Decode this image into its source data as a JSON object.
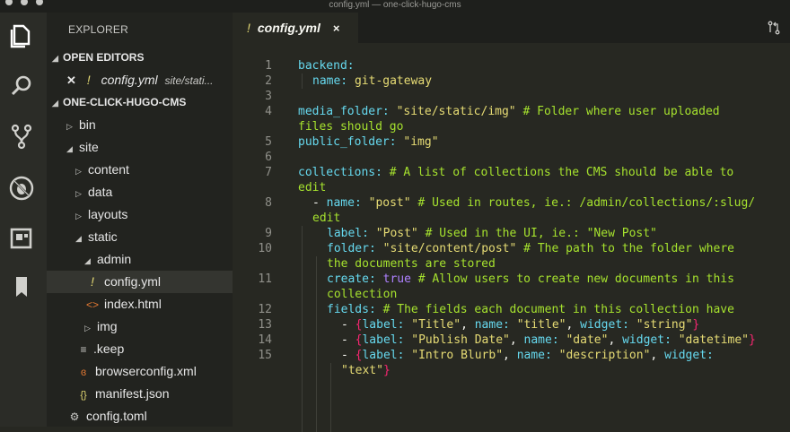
{
  "window": {
    "title": "config.yml — one-click-hugo-cms"
  },
  "sidebar": {
    "header": "EXPLORER",
    "open_editors_label": "OPEN EDITORS",
    "open_editor": {
      "name": "config.yml",
      "path": "site/stati..."
    },
    "project_label": "ONE-CLICK-HUGO-CMS",
    "tree": [
      {
        "label": "bin",
        "type": "folder",
        "state": "collapsed"
      },
      {
        "label": "site",
        "type": "folder",
        "state": "expanded"
      },
      {
        "label": "content",
        "type": "folder",
        "state": "collapsed"
      },
      {
        "label": "data",
        "type": "folder",
        "state": "collapsed"
      },
      {
        "label": "layouts",
        "type": "folder",
        "state": "collapsed"
      },
      {
        "label": "static",
        "type": "folder",
        "state": "expanded"
      },
      {
        "label": "admin",
        "type": "folder",
        "state": "expanded"
      },
      {
        "label": "config.yml",
        "type": "file",
        "icon": "yaml-icon"
      },
      {
        "label": "index.html",
        "type": "file",
        "icon": "html-icon"
      },
      {
        "label": "img",
        "type": "folder",
        "state": "collapsed"
      },
      {
        "label": ".keep",
        "type": "file",
        "icon": "text-file-icon"
      },
      {
        "label": "browserconfig.xml",
        "type": "file",
        "icon": "rss-icon"
      },
      {
        "label": "manifest.json",
        "type": "file",
        "icon": "json-icon"
      },
      {
        "label": "config.toml",
        "type": "file",
        "icon": "gear-file-icon"
      }
    ]
  },
  "editor": {
    "tab": {
      "label": "config.yml",
      "close": "×"
    },
    "line_numbers": [
      "1",
      "2",
      "3",
      "4",
      "",
      "5",
      "6",
      "7",
      "",
      "8",
      "",
      "9",
      "10",
      "",
      "11",
      "",
      "12",
      "13",
      "14",
      "15",
      ""
    ],
    "lines": {
      "l1": "backend:",
      "l2a": "name: ",
      "l2b": "git-gateway",
      "l4a": "media_folder: ",
      "l4b": "\"site/static/img\"",
      "l4c": " # Folder where user uploaded",
      "l4d": "files should go",
      "l5a": "public_folder: ",
      "l5b": "\"img\"",
      "l7a": "collections: ",
      "l7b": "# A list of collections the CMS should be able to",
      "l7c": "edit",
      "l8a": "- ",
      "l8b": "name: ",
      "l8c": "\"post\"",
      "l8d": " # Used in routes, ie.: /admin/collections/:slug/",
      "l8e": "edit",
      "l9a": "label: ",
      "l9b": "\"Post\"",
      "l9c": " # Used in the UI, ie.: \"New Post\"",
      "l10a": "folder: ",
      "l10b": "\"site/content/post\"",
      "l10c": " # The path to the folder where",
      "l10d": "the documents are stored",
      "l11a": "create: ",
      "l11b": "true",
      "l11c": " # Allow users to create new documents in this",
      "l11d": "collection",
      "l12a": "fields: ",
      "l12b": "# The fields each document in this collection have",
      "l13": {
        "dash": "- ",
        "open": "{",
        "k1": "label: ",
        "v1": "\"Title\"",
        "sep": ", ",
        "k2": "name: ",
        "v2": "\"title\"",
        "k3": "widget: ",
        "v3": "\"string\"",
        "close": "}"
      },
      "l14": {
        "dash": "- ",
        "open": "{",
        "k1": "label: ",
        "v1": "\"Publish Date\"",
        "sep": ", ",
        "k2": "name: ",
        "v2": "\"date\"",
        "k3": "widget: ",
        "v3": "\"datetime\"",
        "close": "}"
      },
      "l15": {
        "dash": "- ",
        "open": "{",
        "k1": "label: ",
        "v1": "\"Intro Blurb\"",
        "sep": ", ",
        "k2": "name: ",
        "v2": "\"description\"",
        "k3": "widget: "
      },
      "l15b": "\"text\"",
      "l15c": "}"
    }
  }
}
